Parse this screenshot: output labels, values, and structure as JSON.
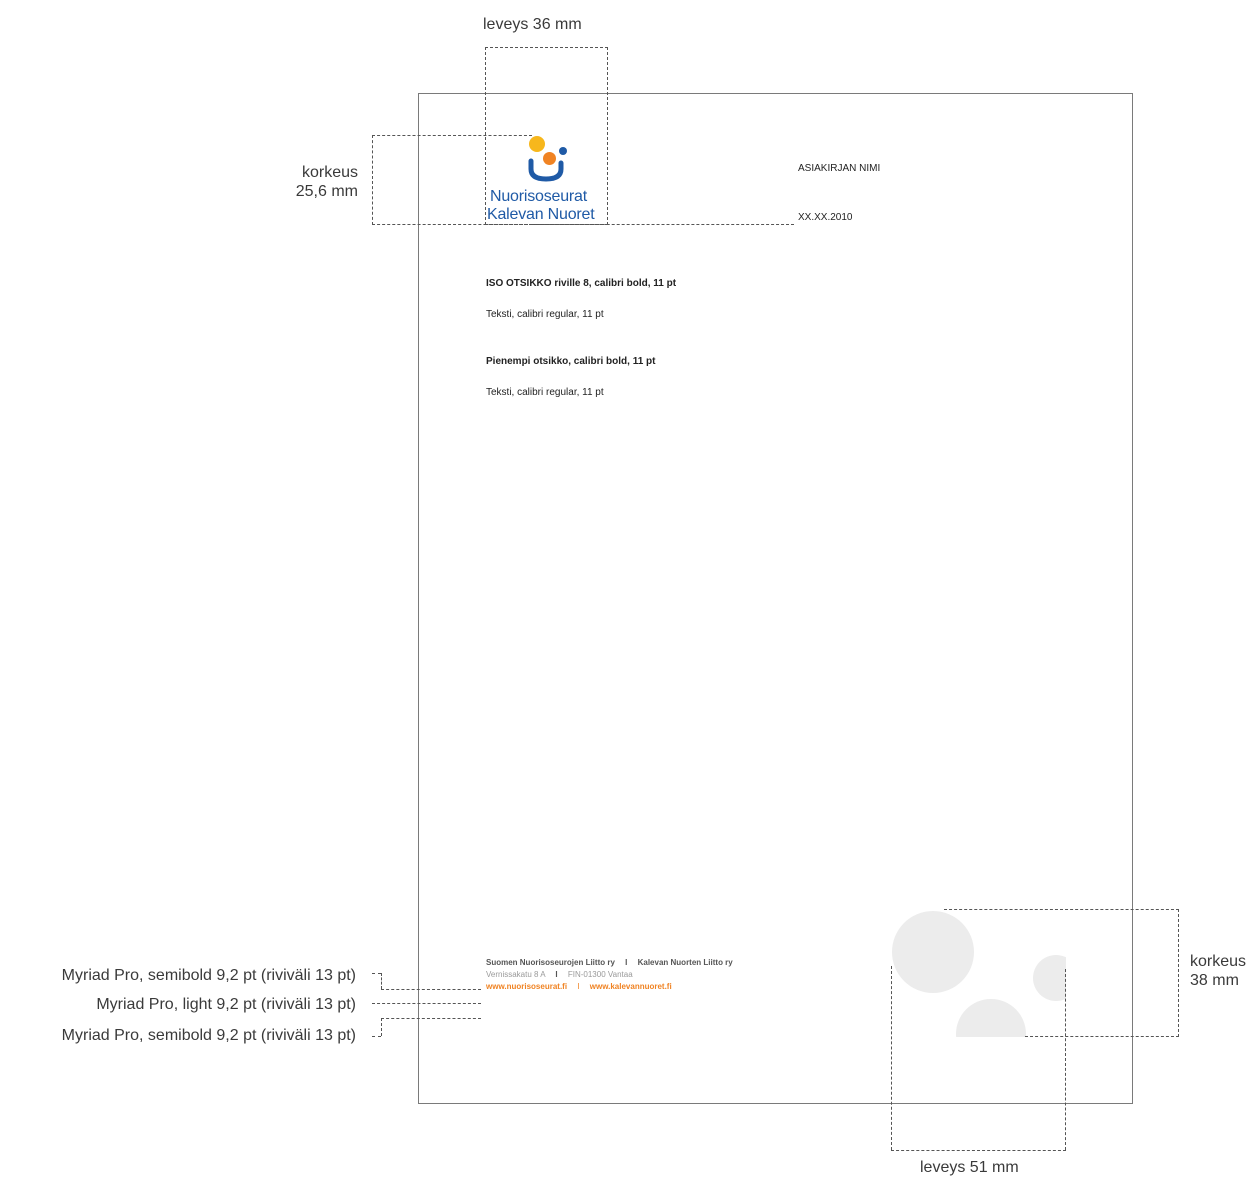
{
  "annotations": {
    "logo_width": "leveys 36 mm",
    "logo_height_line1": "korkeus",
    "logo_height_line2": "25,6 mm",
    "footer_line1_font": "Myriad Pro, semibold 9,2 pt (riviväli 13 pt)",
    "footer_line2_font": "Myriad Pro, light 9,2 pt (riviväli 13 pt)",
    "footer_line3_font": "Myriad Pro, semibold 9,2 pt (riviväli 13 pt)",
    "circles_height_line1": "korkeus",
    "circles_height_line2": "38 mm",
    "circles_width": "leveys 51 mm"
  },
  "logo": {
    "line1": "Nuorisoseurat",
    "line2": "Kalevan Nuoret",
    "colors": {
      "yellow": "#f7b71c",
      "orange": "#f08323",
      "blue": "#1f5aa6"
    }
  },
  "document": {
    "title": "ASIAKIRJAN NIMI",
    "date": "XX.XX.2010",
    "heading1": "ISO OTSIKKO riville 8, calibri bold, 11 pt",
    "text1": "Teksti, calibri regular, 11 pt",
    "heading2": "Pienempi otsikko, calibri bold, 11 pt",
    "text2": "Teksti, calibri regular, 11 pt"
  },
  "footer": {
    "org1": "Suomen Nuorisoseurojen Liitto ry",
    "org2": "Kalevan Nuorten Liitto ry",
    "address": "Vernissakatu 8 A",
    "postal": "FIN-01300 Vantaa",
    "web1": "www.nuorisoseurat.fi",
    "web2": "www.kalevannuoret.fi",
    "separator": "I",
    "accent_color": "#f08323"
  }
}
